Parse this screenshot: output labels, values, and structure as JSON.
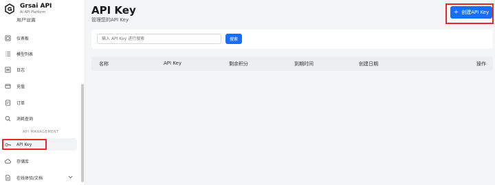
{
  "brand": {
    "title": "Grsai API",
    "subtitle": "AI API Platform"
  },
  "sidebar": {
    "clipped_item": "用户设置",
    "items": [
      {
        "label": "仪表板",
        "icon": "dashboard-icon"
      },
      {
        "label": "模型列表",
        "icon": "list-icon"
      },
      {
        "label": "日志",
        "icon": "log-icon"
      },
      {
        "label": "充值",
        "icon": "wallet-icon"
      },
      {
        "label": "订单",
        "icon": "order-icon"
      },
      {
        "label": "消耗查询",
        "icon": "search-icon"
      }
    ],
    "section_label": "API MANAGEMENT",
    "api_items": [
      {
        "label": "API Key",
        "icon": "key-icon",
        "active": true
      },
      {
        "label": "存储库",
        "icon": "cloud-icon"
      },
      {
        "label": "在线体验/文档",
        "icon": "document-icon"
      }
    ]
  },
  "header": {
    "title": "API Key",
    "subtitle": "管理您的API Key",
    "create_button": "创建API Key"
  },
  "search": {
    "placeholder": "输入 API Key 进行搜索",
    "button": "搜索"
  },
  "table": {
    "columns": [
      "名称",
      "API Key",
      "剩余积分",
      "到期时间",
      "创建日期",
      "操作"
    ]
  },
  "colors": {
    "accent": "#1a6ef5",
    "highlight": "#e5262b"
  }
}
